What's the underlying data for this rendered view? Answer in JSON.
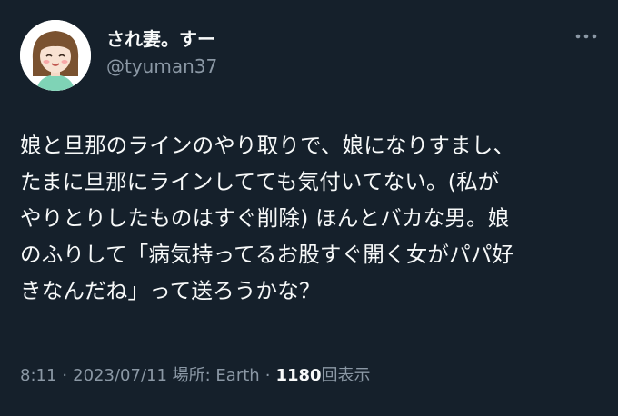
{
  "tweet": {
    "author": {
      "display_name": "され妻。すー",
      "handle": "@tyuman37",
      "avatar_icon": "girl-avatar-icon"
    },
    "more_icon": "more-horizontal-icon",
    "text": "娘と旦那のラインのやり取りで、娘になりすまし、\nたまに旦那にラインしてても気付いてない。(私が\nやりとりしたものはすぐ削除) ほんとバカな男。娘\nのふりして「病気持ってるお股すぐ開く女がパパ好\nきなんだね」って送ろうかな？",
    "meta": {
      "time": "8:11",
      "separator": "·",
      "date": "2023/07/11",
      "location": "場所: Earth",
      "views_count": "1180",
      "views_label": "回表示"
    }
  },
  "colors": {
    "background": "#15202b",
    "primary_text": "#f7f9f9",
    "secondary_text": "#8b98a5"
  }
}
